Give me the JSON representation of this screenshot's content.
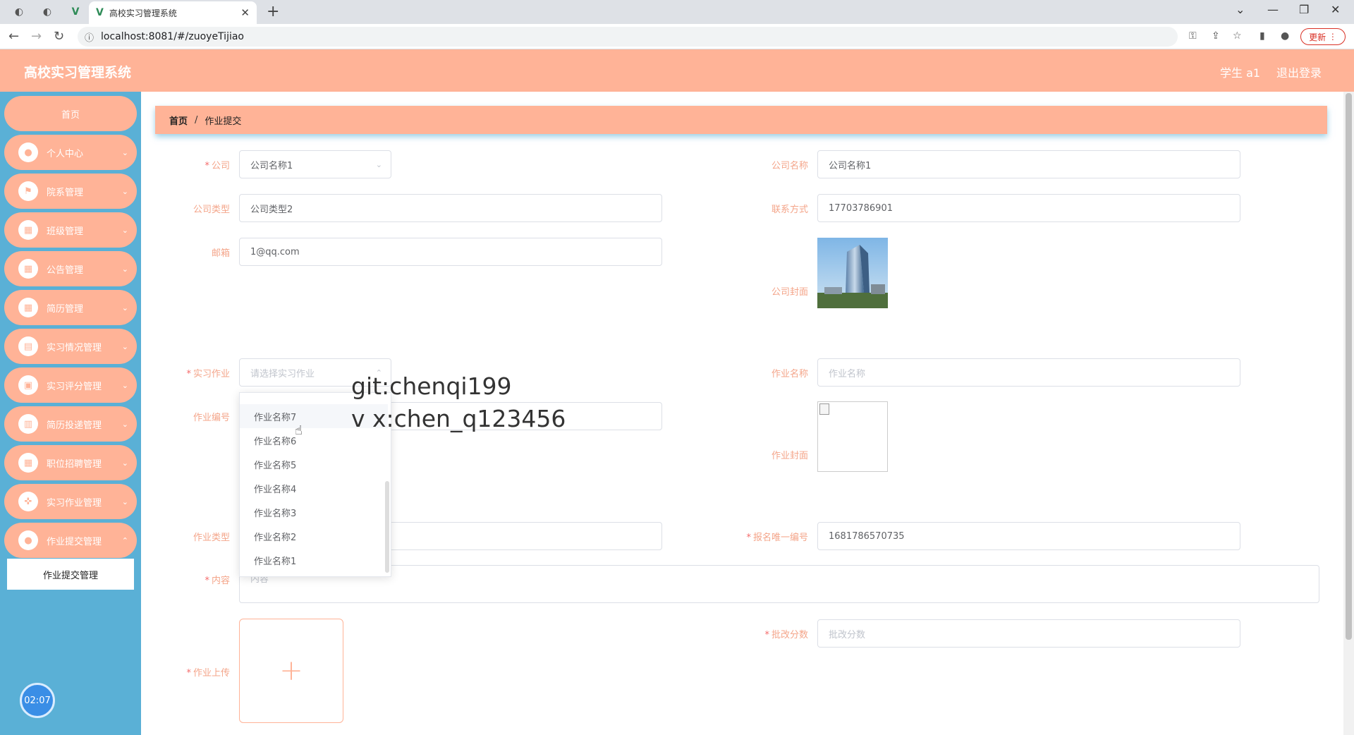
{
  "browser": {
    "tab_title": "高校实习管理系统",
    "url": "localhost:8081/#/zuoyeTijiao",
    "update_label": "更新"
  },
  "header": {
    "title": "高校实习管理系统",
    "user": "学生 a1",
    "logout": "退出登录"
  },
  "sidebar": {
    "items": [
      {
        "label": "首页",
        "icon": "home"
      },
      {
        "label": "个人中心",
        "icon": "user-icon"
      },
      {
        "label": "院系管理",
        "icon": "flag-icon"
      },
      {
        "label": "班级管理",
        "icon": "grid-icon"
      },
      {
        "label": "公告管理",
        "icon": "grid-icon"
      },
      {
        "label": "简历管理",
        "icon": "grid-icon"
      },
      {
        "label": "实习情况管理",
        "icon": "clipboard-icon"
      },
      {
        "label": "实习评分管理",
        "icon": "briefcase-icon"
      },
      {
        "label": "简历投递管理",
        "icon": "chart-icon"
      },
      {
        "label": "职位招聘管理",
        "icon": "grid-icon"
      },
      {
        "label": "实习作业管理",
        "icon": "gamepad-icon"
      },
      {
        "label": "作业提交管理",
        "icon": "user-icon"
      }
    ],
    "sub_item": "作业提交管理",
    "clock": "02:07"
  },
  "breadcrumb": {
    "home": "首页",
    "sep": "/",
    "current": "作业提交"
  },
  "form": {
    "company_label": "公司",
    "company_value": "公司名称1",
    "company_name_label": "公司名称",
    "company_name_value": "公司名称1",
    "company_type_label": "公司类型",
    "company_type_value": "公司类型2",
    "contact_label": "联系方式",
    "contact_value": "17703786901",
    "email_label": "邮箱",
    "email_value": "1@qq.com",
    "company_cover_label": "公司封面",
    "homework_label": "实习作业",
    "homework_placeholder": "请选择实习作业",
    "homework_name_label": "作业名称",
    "homework_name_placeholder": "作业名称",
    "homework_no_label": "作业编号",
    "homework_cover_label": "作业封面",
    "homework_type_label": "作业类型",
    "signup_no_label": "报名唯一编号",
    "signup_no_value": "1681786570735",
    "content_label": "内容",
    "content_placeholder": "内容",
    "upload_label": "作业上传",
    "score_label": "批改分数",
    "score_placeholder": "批改分数"
  },
  "dropdown": {
    "options": [
      "作业名称7",
      "作业名称6",
      "作业名称5",
      "作业名称4",
      "作业名称3",
      "作业名称2",
      "作业名称1"
    ]
  },
  "watermark": {
    "line1": "git:chenqi199",
    "line2": "v x:chen_q123456"
  }
}
